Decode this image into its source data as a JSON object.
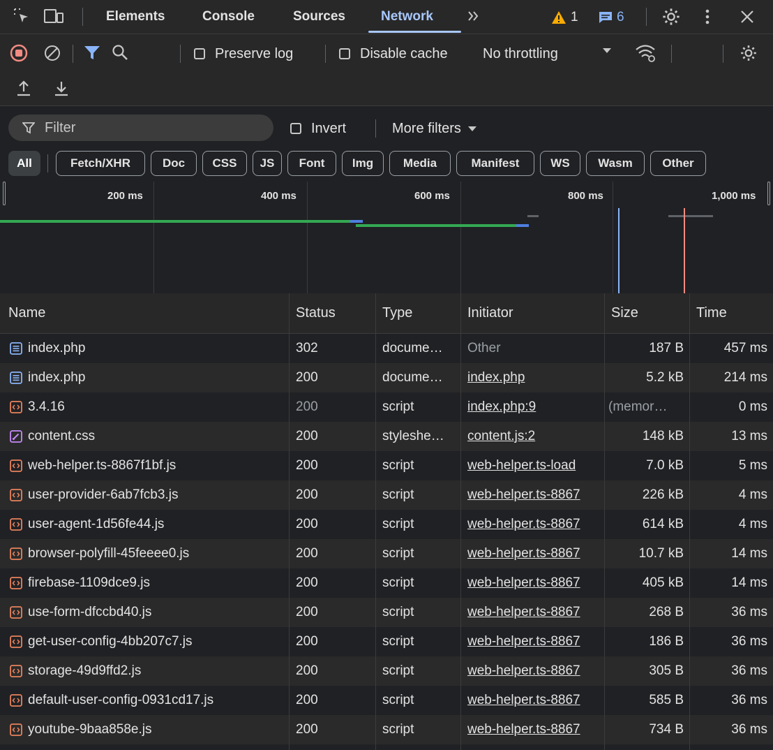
{
  "tabs": {
    "elements": "Elements",
    "console": "Console",
    "sources": "Sources",
    "network": "Network",
    "warnings_count": "1",
    "messages_count": "6"
  },
  "toolbar": {
    "preserve_log": "Preserve log",
    "disable_cache": "Disable cache",
    "throttling": "No throttling"
  },
  "filter": {
    "placeholder": "Filter",
    "invert": "Invert",
    "more_filters": "More filters"
  },
  "type_filters": [
    "All",
    "Fetch/XHR",
    "Doc",
    "CSS",
    "JS",
    "Font",
    "Img",
    "Media",
    "Manifest",
    "WS",
    "Wasm",
    "Other"
  ],
  "timeline": {
    "ticks": [
      "200 ms",
      "400 ms",
      "600 ms",
      "800 ms",
      "1,000 ms"
    ]
  },
  "table": {
    "headers": [
      "Name",
      "Status",
      "Type",
      "Initiator",
      "Size",
      "Time"
    ],
    "rows": [
      {
        "name": "index.php",
        "status": "302",
        "type": "docume…",
        "initiator": "Other",
        "size": "187 B",
        "time": "457 ms",
        "kind": "doc"
      },
      {
        "name": "index.php",
        "status": "200",
        "type": "docume…",
        "initiator": "index.php",
        "size": "5.2 kB",
        "time": "214 ms",
        "kind": "doc"
      },
      {
        "name": "3.4.16",
        "status": "200",
        "type": "script",
        "initiator": "index.php:9",
        "size": "(memor…",
        "time": "0 ms",
        "kind": "script"
      },
      {
        "name": "content.css",
        "status": "200",
        "type": "styleshe…",
        "initiator": "content.js:2",
        "size": "148 kB",
        "time": "13 ms",
        "kind": "css"
      },
      {
        "name": "web-helper.ts-8867f1bf.js",
        "status": "200",
        "type": "script",
        "initiator": "web-helper.ts-load",
        "size": "7.0 kB",
        "time": "5 ms",
        "kind": "script"
      },
      {
        "name": "user-provider-6ab7fcb3.js",
        "status": "200",
        "type": "script",
        "initiator": "web-helper.ts-8867",
        "size": "226 kB",
        "time": "4 ms",
        "kind": "script"
      },
      {
        "name": "user-agent-1d56fe44.js",
        "status": "200",
        "type": "script",
        "initiator": "web-helper.ts-8867",
        "size": "614 kB",
        "time": "4 ms",
        "kind": "script"
      },
      {
        "name": "browser-polyfill-45feeee0.js",
        "status": "200",
        "type": "script",
        "initiator": "web-helper.ts-8867",
        "size": "10.7 kB",
        "time": "14 ms",
        "kind": "script"
      },
      {
        "name": "firebase-1109dce9.js",
        "status": "200",
        "type": "script",
        "initiator": "web-helper.ts-8867",
        "size": "405 kB",
        "time": "14 ms",
        "kind": "script"
      },
      {
        "name": "use-form-dfccbd40.js",
        "status": "200",
        "type": "script",
        "initiator": "web-helper.ts-8867",
        "size": "268 B",
        "time": "36 ms",
        "kind": "script"
      },
      {
        "name": "get-user-config-4bb207c7.js",
        "status": "200",
        "type": "script",
        "initiator": "web-helper.ts-8867",
        "size": "186 B",
        "time": "36 ms",
        "kind": "script"
      },
      {
        "name": "storage-49d9ffd2.js",
        "status": "200",
        "type": "script",
        "initiator": "web-helper.ts-8867",
        "size": "305 B",
        "time": "36 ms",
        "kind": "script"
      },
      {
        "name": "default-user-config-0931cd17.js",
        "status": "200",
        "type": "script",
        "initiator": "web-helper.ts-8867",
        "size": "585 B",
        "time": "36 ms",
        "kind": "script"
      },
      {
        "name": "youtube-9baa858e.js",
        "status": "200",
        "type": "script",
        "initiator": "web-helper.ts-8867",
        "size": "734 B",
        "time": "36 ms",
        "kind": "script"
      }
    ]
  },
  "colors": {
    "accent": "#a8c7fa",
    "record": "#f28b82",
    "warning": "#f9ab00",
    "doc_icon": "#8ab4f8",
    "script_icon": "#e8825e",
    "css_icon": "#c58af9"
  }
}
